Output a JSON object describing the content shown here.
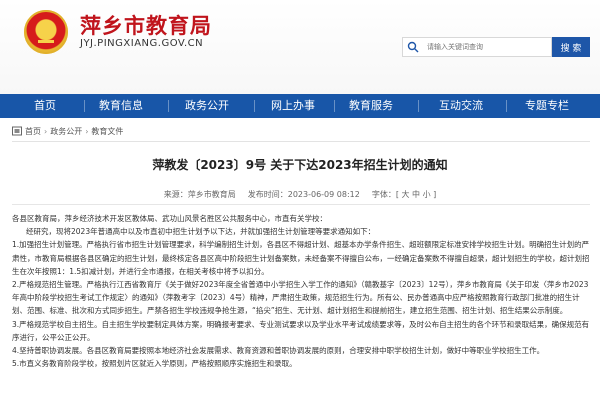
{
  "header": {
    "site_title": "萍乡市教育局",
    "site_domain": "JYJ.PINGXIANG.GOV.CN",
    "search_placeholder": "请输入关键词查询",
    "search_button": "搜 索"
  },
  "nav": {
    "items": [
      "首页",
      "教育信息",
      "政务公开",
      "网上办事",
      "教育服务",
      "互动交流",
      "专题专栏"
    ]
  },
  "breadcrumb": {
    "items": [
      "首页",
      "政务公开",
      "教育文件"
    ],
    "separator": "›"
  },
  "article": {
    "title": "萍教发〔2023〕9号 关于下达2023年招生计划的通知",
    "source": "来源：萍乡市教育局",
    "date": "发布时间：2023-06-09 08:12",
    "font_size_label": "字体：",
    "font_sizes": [
      "[ 大",
      "中",
      "小 ]"
    ],
    "paragraphs": [
      "各县区教育局，萍乡经济技术开发区教体局、武功山风景名胜区公共服务中心，市直有关学校：",
      "经研究，现将2023年普通高中以及市直初中招生计划予以下达，并就加强招生计划管理等要求通知如下：",
      "1.加强招生计划管理。严格执行省市招生计划管理要求，科学编制招生计划，各县区不得超计划、超基本办学条件招生、超班额限定标准安排学校招生计划。明确招生计划的严肃性，市教育局根据各县区确定的招生计划，最终核定各县区高中阶段招生计划备案数，未经备案不得擅自公布，一经确定备案数不得擅自超录，超计划招生的学校，超计划招生在次年按照1：1.5扣减计划，并进行全市通报，在相关考核中将予以扣分。",
      "2.严格规范招生管理。严格执行江西省教育厅《关于做好2023年度全省普通中小学招生入学工作的通知》（赣教基字〔2023〕12号），萍乡市教育局《关于印发〈萍乡市2023年高中阶段学校招生考试工作规定〉的通知》（萍教考字〔2023〕4号）精神，严肃招生政策，规范招生行为。所有公、民办普通高中应严格按照教育行政部门批准的招生计划、范围、标准、批次和方式同步招生。严禁各招生学校违规争抢生源，“掐尖”招生、无计划、超计划招生和提前招生，建立招生范围、招生计划、招生结果公示制度。",
      "3.严格规范学校自主招生。自主招生学校要制定具体方案，明确报考要求、专业测试要求以及学业水平考试成绩要求等，及时公布自主招生的各个环节和录取结果，确保规范有序进行，公平公正公开。",
      "4.坚持普职协调发展。各县区教育局要按照本地经济社会发展需求、教育资源和普职协调发展的原则，合理安排中职学校招生计划，做好中等职业学校招生工作。",
      "5.市直义务教育阶段学校，按照划片区就近入学原则，严格按照顺序实施招生和录取。"
    ]
  },
  "colors": {
    "brand_red": "#c0141c",
    "nav_blue": "#1856a8",
    "search_button_blue": "#1e56a8"
  },
  "icons": {
    "emblem": "national-emblem-icon",
    "search": "search-icon",
    "home": "home-icon"
  }
}
